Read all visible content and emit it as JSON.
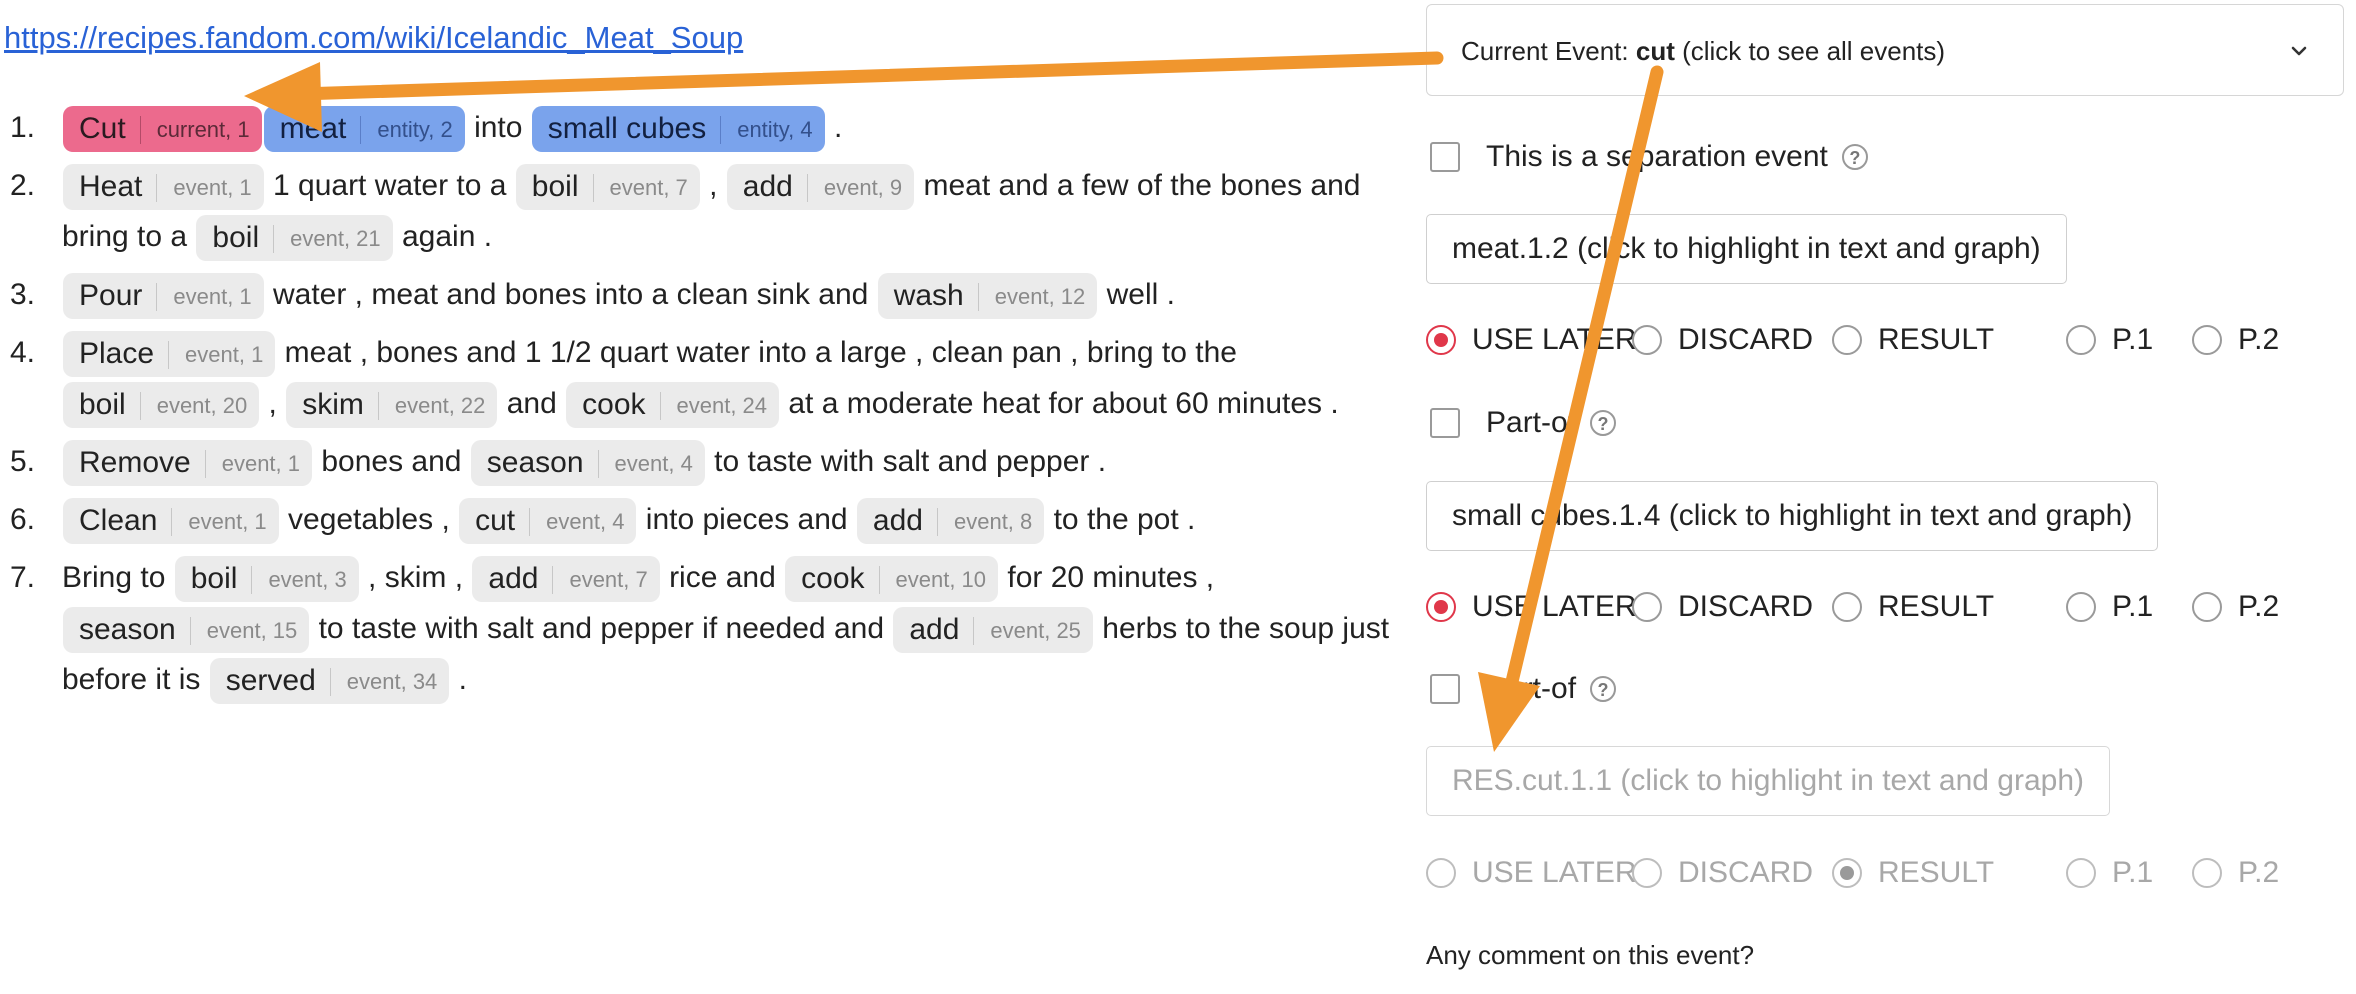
{
  "source_url": "https://recipes.fandom.com/wiki/Icelandic_Meat_Soup",
  "steps": [
    {
      "num": "1.",
      "line1": [
        {
          "type": "token",
          "variant": "current",
          "word": "Cut",
          "ref": "current, 1"
        },
        {
          "type": "token",
          "variant": "entity",
          "word": "meat",
          "ref": "entity, 2"
        },
        {
          "type": "text",
          "text": " into "
        },
        {
          "type": "token",
          "variant": "entity",
          "word": "small cubes",
          "ref": "entity, 4"
        },
        {
          "type": "text",
          "text": " ."
        }
      ]
    },
    {
      "num": "2.",
      "line1": [
        {
          "type": "token",
          "word": "Heat",
          "ref": "event, 1"
        },
        {
          "type": "text",
          "text": " 1 quart water to a "
        },
        {
          "type": "token",
          "word": "boil",
          "ref": "event, 7"
        },
        {
          "type": "text",
          "text": " , "
        },
        {
          "type": "token",
          "word": "add",
          "ref": "event, 9"
        },
        {
          "type": "text",
          "text": " meat and a few of the bones and"
        }
      ],
      "line2": [
        {
          "type": "text",
          "text": "bring to a "
        },
        {
          "type": "token",
          "word": "boil",
          "ref": "event, 21"
        },
        {
          "type": "text",
          "text": " again ."
        }
      ]
    },
    {
      "num": "3.",
      "line1": [
        {
          "type": "token",
          "word": "Pour",
          "ref": "event, 1"
        },
        {
          "type": "text",
          "text": " water , meat and bones into a clean sink and "
        },
        {
          "type": "token",
          "word": "wash",
          "ref": "event, 12"
        },
        {
          "type": "text",
          "text": " well ."
        }
      ]
    },
    {
      "num": "4.",
      "line1": [
        {
          "type": "token",
          "word": "Place",
          "ref": "event, 1"
        },
        {
          "type": "text",
          "text": " meat , bones and 1 1/2 quart water into a large , clean pan , bring to the"
        }
      ],
      "line2": [
        {
          "type": "token",
          "word": "boil",
          "ref": "event, 20"
        },
        {
          "type": "text",
          "text": " , "
        },
        {
          "type": "token",
          "word": "skim",
          "ref": "event, 22"
        },
        {
          "type": "text",
          "text": " and "
        },
        {
          "type": "token",
          "word": "cook",
          "ref": "event, 24"
        },
        {
          "type": "text",
          "text": " at a moderate heat for about 60 minutes ."
        }
      ]
    },
    {
      "num": "5.",
      "line1": [
        {
          "type": "token",
          "word": "Remove",
          "ref": "event, 1"
        },
        {
          "type": "text",
          "text": " bones and "
        },
        {
          "type": "token",
          "word": "season",
          "ref": "event, 4"
        },
        {
          "type": "text",
          "text": " to taste with salt and pepper ."
        }
      ]
    },
    {
      "num": "6.",
      "line1": [
        {
          "type": "token",
          "word": "Clean",
          "ref": "event, 1"
        },
        {
          "type": "text",
          "text": " vegetables , "
        },
        {
          "type": "token",
          "word": "cut",
          "ref": "event, 4"
        },
        {
          "type": "text",
          "text": " into pieces and "
        },
        {
          "type": "token",
          "word": "add",
          "ref": "event, 8"
        },
        {
          "type": "text",
          "text": " to the pot ."
        }
      ]
    },
    {
      "num": "7.",
      "line1": [
        {
          "type": "text",
          "text": "Bring to "
        },
        {
          "type": "token",
          "word": "boil",
          "ref": "event, 3"
        },
        {
          "type": "text",
          "text": " , skim , "
        },
        {
          "type": "token",
          "word": "add",
          "ref": "event, 7"
        },
        {
          "type": "text",
          "text": " rice and "
        },
        {
          "type": "token",
          "word": "cook",
          "ref": "event, 10"
        },
        {
          "type": "text",
          "text": " for 20 minutes ,"
        }
      ],
      "line2": [
        {
          "type": "token",
          "word": "season",
          "ref": "event, 15"
        },
        {
          "type": "text",
          "text": " to taste with salt and pepper if needed and "
        },
        {
          "type": "token",
          "word": "add",
          "ref": "event, 25"
        },
        {
          "type": "text",
          "text": " herbs to the soup just"
        }
      ],
      "line3": [
        {
          "type": "text",
          "text": "before it is "
        },
        {
          "type": "token",
          "word": "served",
          "ref": "event, 34"
        },
        {
          "type": "text",
          "text": " ."
        }
      ]
    }
  ],
  "panel": {
    "dropdown": {
      "prefix": "Current Event: ",
      "event": "cut",
      "suffix": " (click to see all events)"
    },
    "separation_label": "This is a separation event",
    "help_glyph": "?",
    "args": [
      {
        "label": "meat.1.2 (click to highlight in text and graph)",
        "selected": "USE LATER",
        "disabled": false
      },
      {
        "label": "small cubes.1.4 (click to highlight in text and graph)",
        "selected": "USE LATER",
        "disabled": false
      },
      {
        "label": "RES.cut.1.1 (click to highlight in text and graph)",
        "selected": "RESULT",
        "disabled": true
      }
    ],
    "radio_options": [
      "USE LATER",
      "DISCARD",
      "RESULT",
      "P.1",
      "P.2"
    ],
    "part_of_label": "Part-of",
    "comment_label": "Any comment on this event?"
  },
  "colors": {
    "current_token": "#ec6a8d",
    "entity_token": "#7aa3ec",
    "event_token": "#ebebeb",
    "radio_selected": "#e0374a",
    "arrow": "#f0962e",
    "link": "#2962d6"
  },
  "icons": {
    "dropdown": "chevron-down-icon",
    "help": "help-circle-icon"
  }
}
